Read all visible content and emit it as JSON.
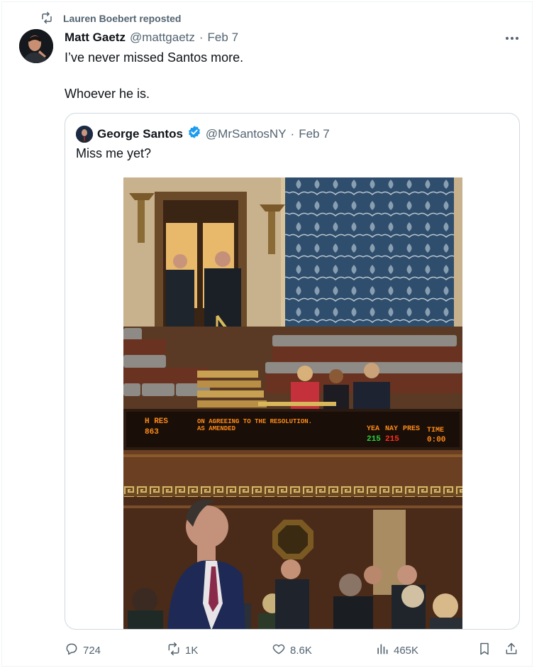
{
  "repost": {
    "label": "Lauren Boebert reposted",
    "icon": "repost-icon"
  },
  "tweet": {
    "author_name": "Matt Gaetz",
    "handle": "@mattgaetz",
    "separator": "·",
    "date": "Feb 7",
    "line1": "I’ve never missed Santos more.",
    "line2": "Whoever he is."
  },
  "quoted": {
    "author_name": "George Santos",
    "handle": "@MrSantosNY",
    "separator": "·",
    "date": "Feb 7",
    "text": "Miss me yet?",
    "verified_color": "#1d9bf0"
  },
  "photo_board": {
    "h_res": "H RES",
    "number": "863",
    "motion_line1": "ON AGREEING TO THE RESOLUTION.",
    "motion_line2": "AS AMENDED",
    "col_yea": "YEA",
    "col_nay": "NAY",
    "col_pres": "PRES",
    "col_time": "TIME",
    "yea": "215",
    "nay": "215",
    "time": "0:00"
  },
  "actions": {
    "replies": "724",
    "reposts": "1K",
    "likes": "8.6K",
    "views": "465K"
  },
  "colors": {
    "text_primary": "#0f1419",
    "text_secondary": "#536471",
    "border": "#cfd9de",
    "led_orange": "#ff8a1a",
    "led_green": "#29d13e",
    "led_red": "#ff2e1f"
  }
}
